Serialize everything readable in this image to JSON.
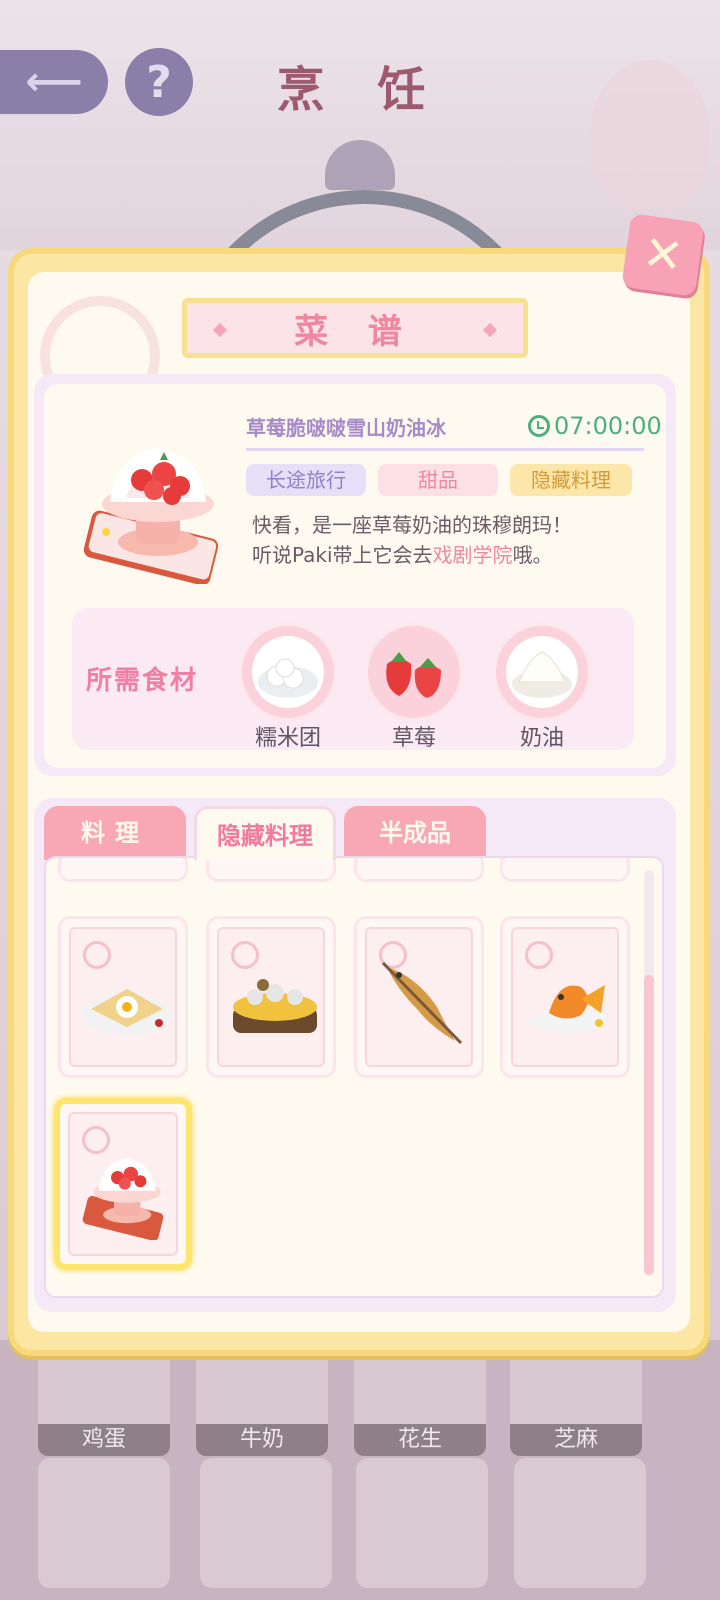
{
  "header": {
    "title": "烹 饪",
    "back_icon": "back-arrow-icon",
    "help_label": "?"
  },
  "modal": {
    "title": "菜 谱",
    "close_label": "✕",
    "dish": {
      "name": "草莓脆啵啵雪山奶油冰",
      "timer": "07:00:00",
      "tags": [
        "长途旅行",
        "甜品",
        "隐藏料理"
      ],
      "desc_part1": "快看，是一座草莓奶油的珠穆朗玛！",
      "desc_part2": "听说Paki带上它会去",
      "desc_highlight": "戏剧学院",
      "desc_part3": "哦。"
    },
    "ingredients_title": "所需食材",
    "ingredients": [
      {
        "name": "糯米团",
        "icon": "rice-ball-icon"
      },
      {
        "name": "草莓",
        "icon": "strawberry-icon"
      },
      {
        "name": "奶油",
        "icon": "cream-icon"
      }
    ],
    "tabs": [
      {
        "label": "料理",
        "active": false
      },
      {
        "label": "隐藏料理",
        "active": true
      },
      {
        "label": "半成品",
        "active": false
      }
    ]
  },
  "inventory": {
    "items": [
      "鸡蛋",
      "牛奶",
      "花生",
      "芝麻"
    ]
  },
  "colors": {
    "accent_pink": "#f0879e",
    "frame_yellow": "#fbe7a3",
    "timer_green": "#4ab07e"
  }
}
